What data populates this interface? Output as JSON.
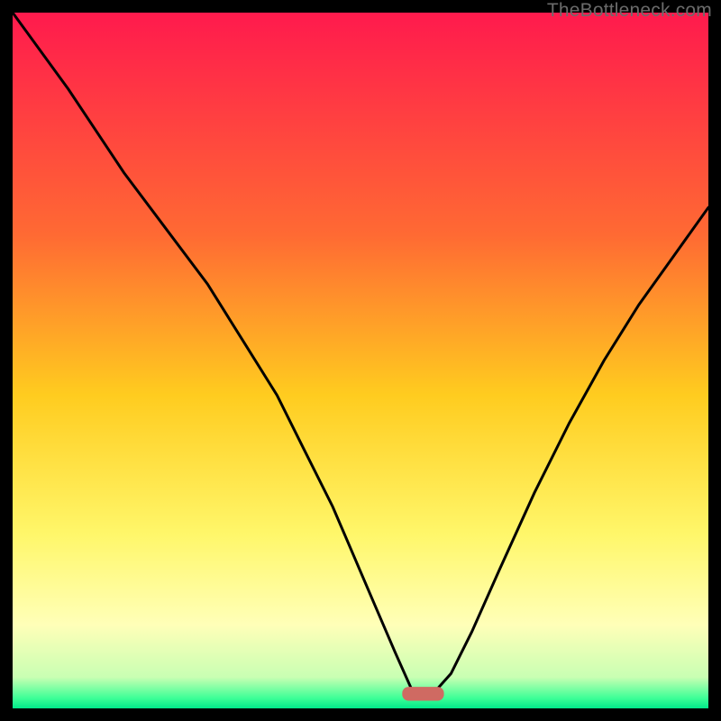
{
  "watermark": "TheBottleneck.com",
  "chart_data": {
    "type": "line",
    "title": "",
    "xlabel": "",
    "ylabel": "",
    "xlim": [
      0,
      100
    ],
    "ylim": [
      0,
      100
    ],
    "grid": false,
    "legend": false,
    "background_gradient": {
      "stops": [
        {
          "pos": 0.0,
          "color": "#ff1a4d"
        },
        {
          "pos": 0.32,
          "color": "#ff6a33"
        },
        {
          "pos": 0.55,
          "color": "#ffcc1f"
        },
        {
          "pos": 0.75,
          "color": "#fff76a"
        },
        {
          "pos": 0.88,
          "color": "#ffffb8"
        },
        {
          "pos": 0.955,
          "color": "#c9ffb3"
        },
        {
          "pos": 0.985,
          "color": "#3fff97"
        },
        {
          "pos": 1.0,
          "color": "#00e889"
        }
      ]
    },
    "series": [
      {
        "name": "bottleneck-curve",
        "x": [
          0,
          8,
          16,
          22,
          28,
          33,
          38,
          42,
          46,
          49,
          52,
          55,
          57.5,
          60.5,
          63,
          66,
          70,
          75,
          80,
          85,
          90,
          95,
          100
        ],
        "y": [
          100,
          89,
          77,
          69,
          61,
          53,
          45,
          37,
          29,
          22,
          15,
          8,
          2.4,
          2.2,
          5,
          11,
          20,
          31,
          41,
          50,
          58,
          65,
          72
        ]
      }
    ],
    "marker": {
      "name": "optimal-zone",
      "shape": "rounded-rect",
      "center_x": 59,
      "y": 2.1,
      "width": 6.0,
      "height": 2.0,
      "color": "#cf6a62"
    }
  }
}
